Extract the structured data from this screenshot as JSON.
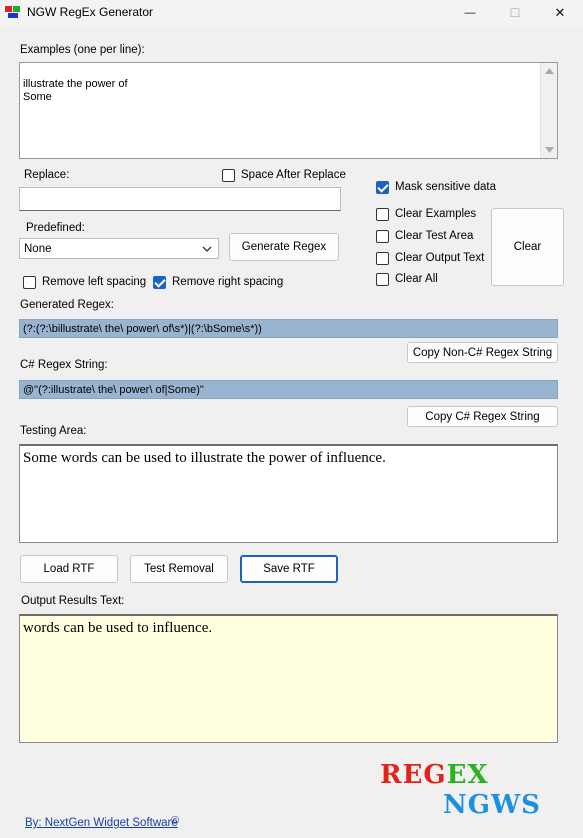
{
  "window": {
    "title": "NGW RegEx Generator",
    "minimize_glyph": "—",
    "maximize_glyph": "☐",
    "close_glyph": "✕"
  },
  "examples": {
    "label": "Examples (one per line):",
    "value": "illustrate the power of\nSome"
  },
  "replace": {
    "label": "Replace:",
    "value": ""
  },
  "space_after_replace": {
    "label": "Space After Replace",
    "checked": false
  },
  "mask_sensitive": {
    "label": "Mask sensitive data",
    "checked": true
  },
  "predefined": {
    "label": "Predefined:",
    "selected": "None"
  },
  "generate_button": "Generate Regex",
  "clear_options": [
    {
      "label": "Clear Examples",
      "checked": false
    },
    {
      "label": "Clear Test Area",
      "checked": false
    },
    {
      "label": "Clear Output Text",
      "checked": false
    },
    {
      "label": "Clear All",
      "checked": false
    }
  ],
  "clear_button": "Clear",
  "remove_left": {
    "label": "Remove left spacing",
    "checked": false
  },
  "remove_right": {
    "label": "Remove right spacing",
    "checked": true
  },
  "generated": {
    "label": "Generated Regex:",
    "value": "(?:(?:\\billustrate\\ the\\ power\\ of\\s*)|(?:\\bSome\\s*))",
    "copy_button": "Copy Non-C# Regex String"
  },
  "csharp": {
    "label": "C# Regex String:",
    "value": "@\"(?:illustrate\\ the\\ power\\ of|Some)\"",
    "copy_button": "Copy C# Regex String"
  },
  "testing": {
    "label": "Testing Area:",
    "value": "Some words can be used to illustrate the power of influence."
  },
  "buttons": {
    "load": "Load RTF",
    "test": "Test Removal",
    "save": "Save RTF"
  },
  "output": {
    "label": "Output Results Text:",
    "value": "words can be used to influence."
  },
  "logo": {
    "line1": "REGEX",
    "line2": "NGWS"
  },
  "footer_link": "By: NextGen Widget Software",
  "footer_glyph": "©",
  "colors": {
    "accent": "#1a63c2",
    "regex_field": "#99b4d1",
    "output_bg": "#ffffe0",
    "logo_red": "#e32219",
    "logo_green": "#2bb21f",
    "logo_blue": "#1e90e0"
  }
}
